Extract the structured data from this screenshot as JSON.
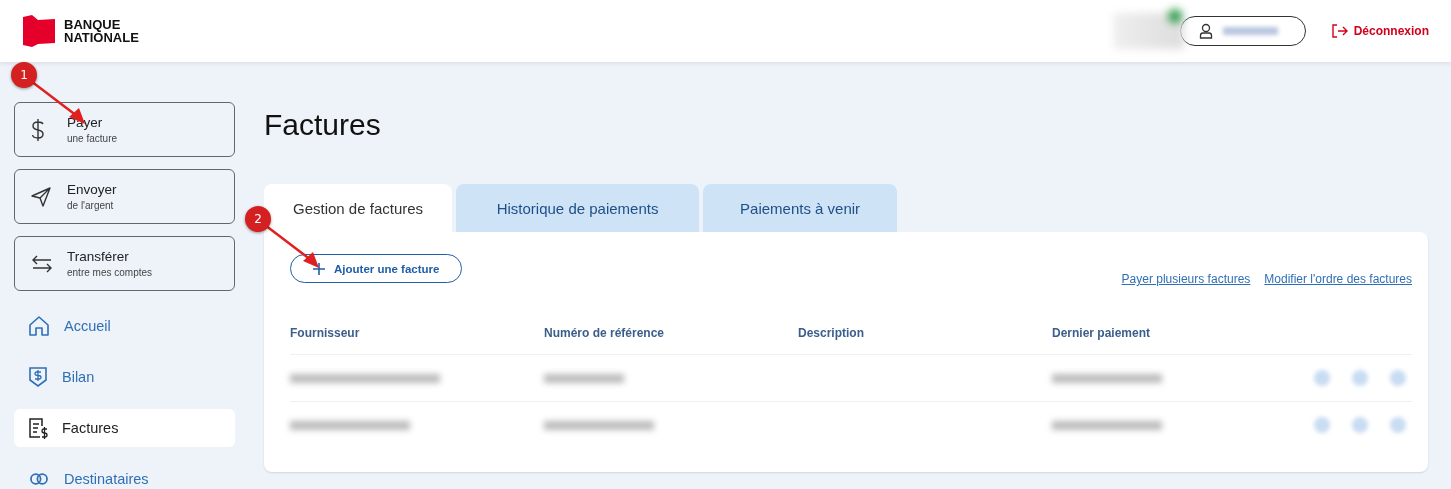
{
  "header": {
    "logo_text": [
      "BANQUE",
      "NATIONALE"
    ],
    "logout": "Déconnexion"
  },
  "sidebar": {
    "actions": [
      {
        "title": "Payer",
        "subtitle": "une facture"
      },
      {
        "title": "Envoyer",
        "subtitle": "de l'argent"
      },
      {
        "title": "Transférer",
        "subtitle": "entre mes comptes"
      }
    ],
    "nav": [
      {
        "label": "Accueil",
        "selected": false
      },
      {
        "label": "Bilan",
        "selected": false
      },
      {
        "label": "Factures",
        "selected": true
      },
      {
        "label": "Destinataires",
        "selected": false
      }
    ]
  },
  "page_title": "Factures",
  "tabs": [
    {
      "label": "Gestion de factures",
      "selected": true
    },
    {
      "label": "Historique de paiements",
      "selected": false
    },
    {
      "label": "Paiements à venir",
      "selected": false
    }
  ],
  "add_button": "Ajouter une facture",
  "links": [
    "Payer plusieurs factures",
    "Modifier l'ordre des factures"
  ],
  "table": {
    "columns": [
      "Fournisseur",
      "Numéro de référence",
      "Description",
      "Dernier paiement"
    ]
  },
  "annotations": [
    {
      "label": "1"
    },
    {
      "label": "2"
    }
  ]
}
